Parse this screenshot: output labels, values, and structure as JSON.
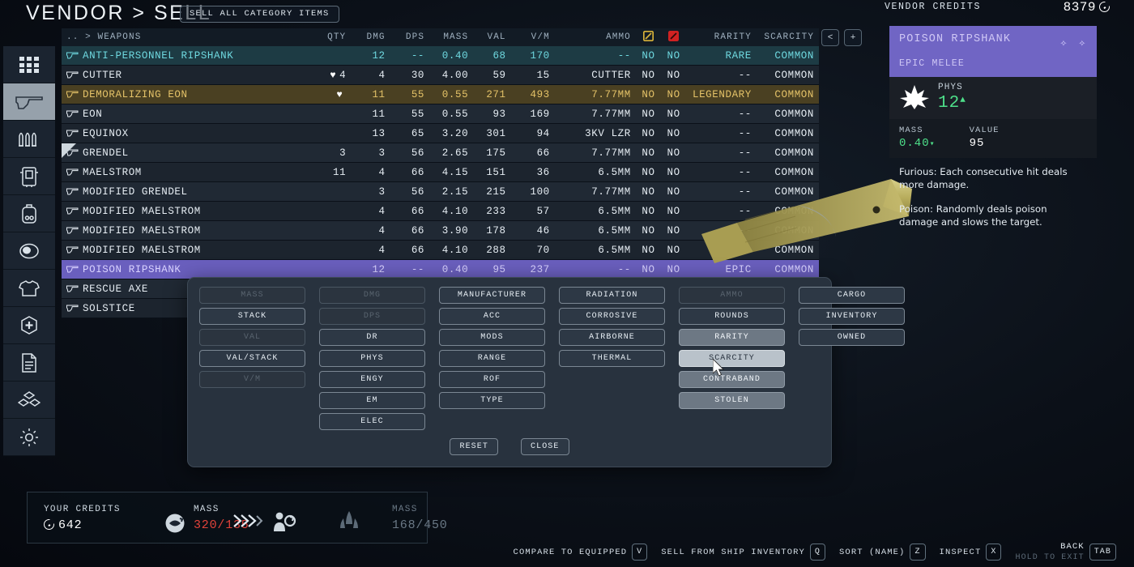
{
  "header": {
    "title": "VENDOR > SELL",
    "sell_all_label": "SELL ALL CATEGORY ITEMS",
    "vendor_credits_label": "VENDOR CREDITS",
    "vendor_credits_value": "8379"
  },
  "sidebar": {
    "items": [
      {
        "icon": "grid-all-icon",
        "name": "all"
      },
      {
        "icon": "weapon-gun-icon",
        "name": "weapons",
        "active": true
      },
      {
        "icon": "ammo-icon",
        "name": "ammo"
      },
      {
        "icon": "spacesuit-icon",
        "name": "spacesuits"
      },
      {
        "icon": "backpack-icon",
        "name": "packs"
      },
      {
        "icon": "helmet-icon",
        "name": "helmets"
      },
      {
        "icon": "apparel-icon",
        "name": "apparel"
      },
      {
        "icon": "aid-icon",
        "name": "aid"
      },
      {
        "icon": "notes-icon",
        "name": "notes"
      },
      {
        "icon": "resources-icon",
        "name": "resources"
      },
      {
        "icon": "gear-icon",
        "name": "misc"
      }
    ]
  },
  "table": {
    "breadcrumb": ".. > WEAPONS",
    "columns": [
      "QTY",
      "DMG",
      "DPS",
      "MASS",
      "VAL",
      "V/M",
      "AMMO",
      "contraband-icon",
      "stolen-icon",
      "RARITY",
      "SCARCITY"
    ],
    "headers": {
      "qty": "QTY",
      "dmg": "DMG",
      "dps": "DPS",
      "mass": "MASS",
      "val": "VAL",
      "vm": "V/M",
      "ammo": "AMMO",
      "rarity": "RARITY",
      "scarcity": "SCARCITY"
    },
    "page_prev": "<",
    "page_add": "+",
    "rows": [
      {
        "name": "ANTI-PERSONNEL RIPSHANK",
        "fav": false,
        "new": false,
        "qty": "",
        "dmg": "12",
        "dps": "--",
        "mass": "0.40",
        "val": "68",
        "vm": "170",
        "ammo": "--",
        "contraband": "NO",
        "stolen": "NO",
        "rarity": "RARE",
        "scarcity": "COMMON",
        "style": "sel"
      },
      {
        "name": "CUTTER",
        "fav": true,
        "new": false,
        "qty": "4",
        "dmg": "4",
        "dps": "30",
        "mass": "4.00",
        "val": "59",
        "vm": "15",
        "ammo": "CUTTER",
        "contraband": "NO",
        "stolen": "NO",
        "rarity": "--",
        "scarcity": "COMMON",
        "style": "normal"
      },
      {
        "name": "DEMORALIZING EON",
        "fav": true,
        "new": false,
        "qty": "",
        "dmg": "11",
        "dps": "55",
        "mass": "0.55",
        "val": "271",
        "vm": "493",
        "ammo": "7.77MM",
        "contraband": "NO",
        "stolen": "NO",
        "rarity": "LEGENDARY",
        "scarcity": "COMMON",
        "style": "legend"
      },
      {
        "name": "EON",
        "fav": false,
        "new": false,
        "qty": "",
        "dmg": "11",
        "dps": "55",
        "mass": "0.55",
        "val": "93",
        "vm": "169",
        "ammo": "7.77MM",
        "contraband": "NO",
        "stolen": "NO",
        "rarity": "--",
        "scarcity": "COMMON",
        "style": "alt"
      },
      {
        "name": "EQUINOX",
        "fav": false,
        "new": false,
        "qty": "",
        "dmg": "13",
        "dps": "65",
        "mass": "3.20",
        "val": "301",
        "vm": "94",
        "ammo": "3KV LZR",
        "contraband": "NO",
        "stolen": "NO",
        "rarity": "--",
        "scarcity": "COMMON",
        "style": "normal"
      },
      {
        "name": "GRENDEL",
        "fav": false,
        "new": true,
        "qty": "3",
        "dmg": "3",
        "dps": "56",
        "mass": "2.65",
        "val": "175",
        "vm": "66",
        "ammo": "7.77MM",
        "contraband": "NO",
        "stolen": "NO",
        "rarity": "--",
        "scarcity": "COMMON",
        "style": "alt"
      },
      {
        "name": "MAELSTROM",
        "fav": false,
        "new": false,
        "qty": "11",
        "dmg": "4",
        "dps": "66",
        "mass": "4.15",
        "val": "151",
        "vm": "36",
        "ammo": "6.5MM",
        "contraband": "NO",
        "stolen": "NO",
        "rarity": "--",
        "scarcity": "COMMON",
        "style": "normal"
      },
      {
        "name": "MODIFIED GRENDEL",
        "fav": false,
        "new": false,
        "qty": "",
        "dmg": "3",
        "dps": "56",
        "mass": "2.15",
        "val": "215",
        "vm": "100",
        "ammo": "7.77MM",
        "contraband": "NO",
        "stolen": "NO",
        "rarity": "--",
        "scarcity": "COMMON",
        "style": "alt"
      },
      {
        "name": "MODIFIED MAELSTROM",
        "fav": false,
        "new": false,
        "qty": "",
        "dmg": "4",
        "dps": "66",
        "mass": "4.10",
        "val": "233",
        "vm": "57",
        "ammo": "6.5MM",
        "contraband": "NO",
        "stolen": "NO",
        "rarity": "--",
        "scarcity": "COMMON",
        "style": "normal"
      },
      {
        "name": "MODIFIED MAELSTROM",
        "fav": false,
        "new": false,
        "qty": "",
        "dmg": "4",
        "dps": "66",
        "mass": "3.90",
        "val": "178",
        "vm": "46",
        "ammo": "6.5MM",
        "contraband": "NO",
        "stolen": "NO",
        "rarity": "--",
        "scarcity": "COMMON",
        "style": "alt"
      },
      {
        "name": "MODIFIED MAELSTROM",
        "fav": false,
        "new": false,
        "qty": "",
        "dmg": "4",
        "dps": "66",
        "mass": "4.10",
        "val": "288",
        "vm": "70",
        "ammo": "6.5MM",
        "contraband": "NO",
        "stolen": "NO",
        "rarity": "--",
        "scarcity": "COMMON",
        "style": "normal"
      },
      {
        "name": "POISON RIPSHANK",
        "fav": false,
        "new": false,
        "qty": "",
        "dmg": "12",
        "dps": "--",
        "mass": "0.40",
        "val": "95",
        "vm": "237",
        "ammo": "--",
        "contraband": "NO",
        "stolen": "NO",
        "rarity": "EPIC",
        "scarcity": "COMMON",
        "style": "epic"
      },
      {
        "name": "RESCUE AXE",
        "fav": false,
        "new": false,
        "qty": "",
        "dmg": "",
        "dps": "",
        "mass": "",
        "val": "",
        "vm": "",
        "ammo": "",
        "contraband": "",
        "stolen": "",
        "rarity": "",
        "scarcity": "",
        "style": "alt"
      },
      {
        "name": "SOLSTICE",
        "fav": false,
        "new": false,
        "qty": "",
        "dmg": "",
        "dps": "",
        "mass": "",
        "val": "",
        "vm": "",
        "ammo": "",
        "contraband": "",
        "stolen": "",
        "rarity": "",
        "scarcity": "",
        "style": "normal"
      }
    ]
  },
  "detail": {
    "name": "POISON RIPSHANK",
    "type": "EPIC MELEE",
    "stars": "✧ ✧",
    "stat_icon": "phys-damage-icon",
    "stat_label": "PHYS",
    "stat_value": "12",
    "stat_arrow": "▲",
    "mass_label": "MASS",
    "mass_value": "0.40",
    "mass_arrow": "▾",
    "value_label": "VALUE",
    "value_value": "95",
    "desc_1": "Furious: Each consecutive hit deals more damage.",
    "desc_2": "Poison: Randomly deals poison damage and slows the target."
  },
  "filter_panel": {
    "columns": [
      {
        "buttons": [
          {
            "label": "MASS",
            "state": "disabled"
          },
          {
            "label": "STACK",
            "state": "normal"
          },
          {
            "label": "VAL",
            "state": "disabled"
          },
          {
            "label": "VAL/STACK",
            "state": "normal"
          },
          {
            "label": "V/M",
            "state": "disabled"
          }
        ]
      },
      {
        "buttons": [
          {
            "label": "DMG",
            "state": "disabled"
          },
          {
            "label": "DPS",
            "state": "disabled"
          },
          {
            "label": "DR",
            "state": "normal"
          },
          {
            "label": "PHYS",
            "state": "normal"
          },
          {
            "label": "ENGY",
            "state": "normal"
          },
          {
            "label": "EM",
            "state": "normal"
          },
          {
            "label": "ELEC",
            "state": "normal"
          }
        ]
      },
      {
        "buttons": [
          {
            "label": "MANUFACTURER",
            "state": "normal"
          },
          {
            "label": "ACC",
            "state": "normal"
          },
          {
            "label": "MODS",
            "state": "normal"
          },
          {
            "label": "RANGE",
            "state": "normal"
          },
          {
            "label": "ROF",
            "state": "normal"
          },
          {
            "label": "TYPE",
            "state": "normal"
          }
        ]
      },
      {
        "buttons": [
          {
            "label": "RADIATION",
            "state": "normal"
          },
          {
            "label": "CORROSIVE",
            "state": "normal"
          },
          {
            "label": "AIRBORNE",
            "state": "normal"
          },
          {
            "label": "THERMAL",
            "state": "normal"
          }
        ]
      },
      {
        "buttons": [
          {
            "label": "AMMO",
            "state": "disabled"
          },
          {
            "label": "ROUNDS",
            "state": "normal"
          },
          {
            "label": "RARITY",
            "state": "on"
          },
          {
            "label": "SCARCITY",
            "state": "hover"
          },
          {
            "label": "CONTRABAND",
            "state": "on"
          },
          {
            "label": "STOLEN",
            "state": "on"
          }
        ]
      },
      {
        "buttons": [
          {
            "label": "CARGO",
            "state": "normal"
          },
          {
            "label": "INVENTORY",
            "state": "normal"
          },
          {
            "label": "OWNED",
            "state": "normal"
          }
        ]
      }
    ],
    "reset_label": "RESET",
    "close_label": "CLOSE"
  },
  "status_bar": {
    "credits_label": "YOUR CREDITS",
    "credits_value": "642",
    "mass_label": "MASS",
    "mass_value": "320/135",
    "ship_mass_label": "MASS",
    "ship_mass_value": "168/450",
    "transfer_icon": "chevrons-right-icon",
    "person_icon": "person-credits-icon",
    "ship_icon": "ship-icon",
    "mass_icon": "mass-icon"
  },
  "hints": [
    {
      "label": "COMPARE TO EQUIPPED",
      "key": "V"
    },
    {
      "label": "SELL FROM SHIP INVENTORY",
      "key": "Q"
    },
    {
      "label": "SORT (NAME)",
      "key": "Z"
    },
    {
      "label": "INSPECT",
      "key": "X"
    }
  ],
  "back_hint": {
    "line1": "BACK",
    "line2": "HOLD TO EXIT",
    "key": "TAB"
  },
  "colors": {
    "accent_cyan": "#6fd9e0",
    "legendary": "#e4c268",
    "epic": "#6a5fbe",
    "green": "#4ee08a",
    "red": "#e0423a",
    "panel": "#28323e"
  }
}
